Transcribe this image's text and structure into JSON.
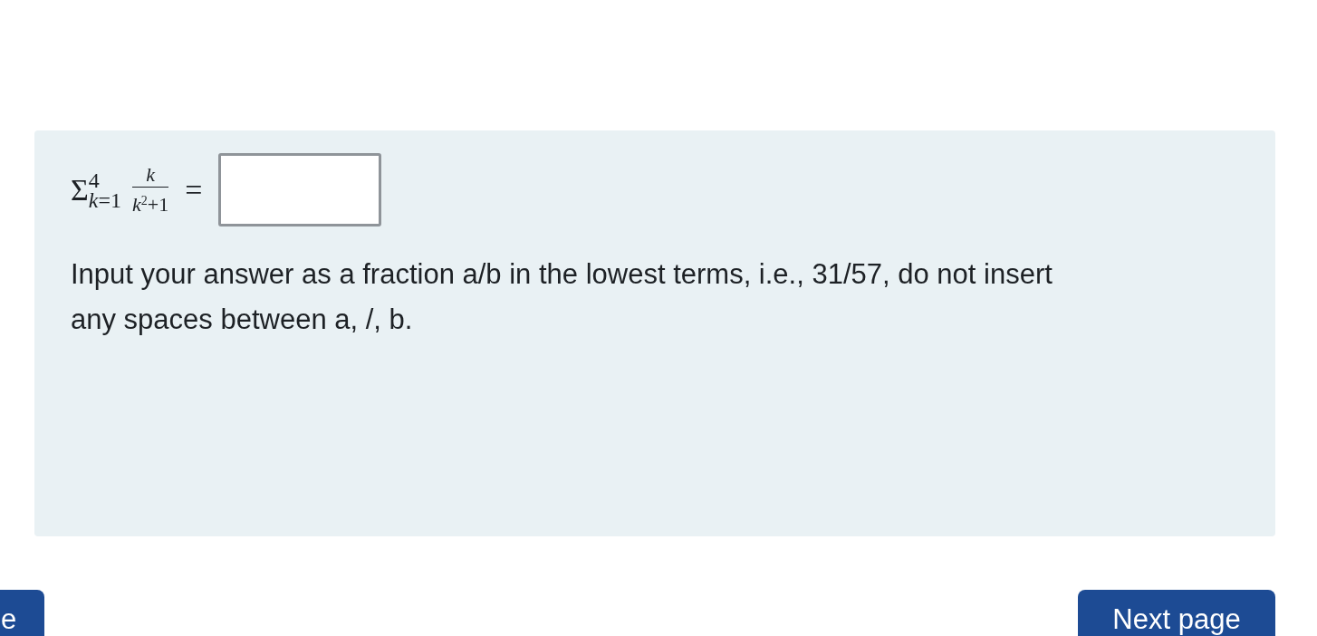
{
  "question": {
    "formula": {
      "operator": "Σ",
      "upper": "4",
      "lower": "*k*=1",
      "numerator": "k",
      "denominator": "*k*$^{2}$+1",
      "relation": "="
    },
    "instructions": "Input your answer as a fraction a/b in the lowest terms, i.e., 31/57, do not insert any spaces between a, /, b."
  },
  "navigation": [
    {
      "kind": "previous",
      "label": "e"
    },
    {
      "kind": "next",
      "label": "Next page"
    }
  ]
}
